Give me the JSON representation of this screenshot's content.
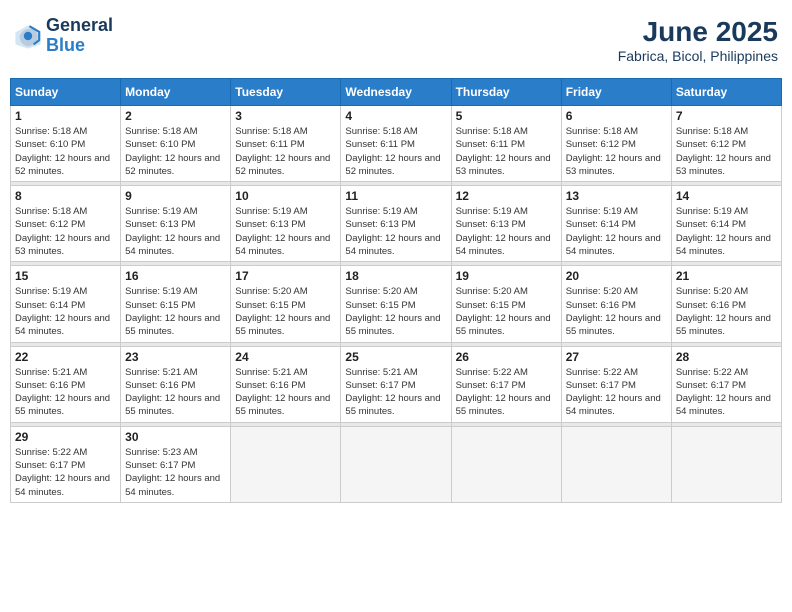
{
  "header": {
    "logo_general": "General",
    "logo_blue": "Blue",
    "title": "June 2025",
    "subtitle": "Fabrica, Bicol, Philippines"
  },
  "weekdays": [
    "Sunday",
    "Monday",
    "Tuesday",
    "Wednesday",
    "Thursday",
    "Friday",
    "Saturday"
  ],
  "weeks": [
    [
      {
        "day": "1",
        "sunrise": "5:18 AM",
        "sunset": "6:10 PM",
        "daylight": "12 hours and 52 minutes."
      },
      {
        "day": "2",
        "sunrise": "5:18 AM",
        "sunset": "6:10 PM",
        "daylight": "12 hours and 52 minutes."
      },
      {
        "day": "3",
        "sunrise": "5:18 AM",
        "sunset": "6:11 PM",
        "daylight": "12 hours and 52 minutes."
      },
      {
        "day": "4",
        "sunrise": "5:18 AM",
        "sunset": "6:11 PM",
        "daylight": "12 hours and 52 minutes."
      },
      {
        "day": "5",
        "sunrise": "5:18 AM",
        "sunset": "6:11 PM",
        "daylight": "12 hours and 53 minutes."
      },
      {
        "day": "6",
        "sunrise": "5:18 AM",
        "sunset": "6:12 PM",
        "daylight": "12 hours and 53 minutes."
      },
      {
        "day": "7",
        "sunrise": "5:18 AM",
        "sunset": "6:12 PM",
        "daylight": "12 hours and 53 minutes."
      }
    ],
    [
      {
        "day": "8",
        "sunrise": "5:18 AM",
        "sunset": "6:12 PM",
        "daylight": "12 hours and 53 minutes."
      },
      {
        "day": "9",
        "sunrise": "5:19 AM",
        "sunset": "6:13 PM",
        "daylight": "12 hours and 54 minutes."
      },
      {
        "day": "10",
        "sunrise": "5:19 AM",
        "sunset": "6:13 PM",
        "daylight": "12 hours and 54 minutes."
      },
      {
        "day": "11",
        "sunrise": "5:19 AM",
        "sunset": "6:13 PM",
        "daylight": "12 hours and 54 minutes."
      },
      {
        "day": "12",
        "sunrise": "5:19 AM",
        "sunset": "6:13 PM",
        "daylight": "12 hours and 54 minutes."
      },
      {
        "day": "13",
        "sunrise": "5:19 AM",
        "sunset": "6:14 PM",
        "daylight": "12 hours and 54 minutes."
      },
      {
        "day": "14",
        "sunrise": "5:19 AM",
        "sunset": "6:14 PM",
        "daylight": "12 hours and 54 minutes."
      }
    ],
    [
      {
        "day": "15",
        "sunrise": "5:19 AM",
        "sunset": "6:14 PM",
        "daylight": "12 hours and 54 minutes."
      },
      {
        "day": "16",
        "sunrise": "5:19 AM",
        "sunset": "6:15 PM",
        "daylight": "12 hours and 55 minutes."
      },
      {
        "day": "17",
        "sunrise": "5:20 AM",
        "sunset": "6:15 PM",
        "daylight": "12 hours and 55 minutes."
      },
      {
        "day": "18",
        "sunrise": "5:20 AM",
        "sunset": "6:15 PM",
        "daylight": "12 hours and 55 minutes."
      },
      {
        "day": "19",
        "sunrise": "5:20 AM",
        "sunset": "6:15 PM",
        "daylight": "12 hours and 55 minutes."
      },
      {
        "day": "20",
        "sunrise": "5:20 AM",
        "sunset": "6:16 PM",
        "daylight": "12 hours and 55 minutes."
      },
      {
        "day": "21",
        "sunrise": "5:20 AM",
        "sunset": "6:16 PM",
        "daylight": "12 hours and 55 minutes."
      }
    ],
    [
      {
        "day": "22",
        "sunrise": "5:21 AM",
        "sunset": "6:16 PM",
        "daylight": "12 hours and 55 minutes."
      },
      {
        "day": "23",
        "sunrise": "5:21 AM",
        "sunset": "6:16 PM",
        "daylight": "12 hours and 55 minutes."
      },
      {
        "day": "24",
        "sunrise": "5:21 AM",
        "sunset": "6:16 PM",
        "daylight": "12 hours and 55 minutes."
      },
      {
        "day": "25",
        "sunrise": "5:21 AM",
        "sunset": "6:17 PM",
        "daylight": "12 hours and 55 minutes."
      },
      {
        "day": "26",
        "sunrise": "5:22 AM",
        "sunset": "6:17 PM",
        "daylight": "12 hours and 55 minutes."
      },
      {
        "day": "27",
        "sunrise": "5:22 AM",
        "sunset": "6:17 PM",
        "daylight": "12 hours and 54 minutes."
      },
      {
        "day": "28",
        "sunrise": "5:22 AM",
        "sunset": "6:17 PM",
        "daylight": "12 hours and 54 minutes."
      }
    ],
    [
      {
        "day": "29",
        "sunrise": "5:22 AM",
        "sunset": "6:17 PM",
        "daylight": "12 hours and 54 minutes."
      },
      {
        "day": "30",
        "sunrise": "5:23 AM",
        "sunset": "6:17 PM",
        "daylight": "12 hours and 54 minutes."
      },
      null,
      null,
      null,
      null,
      null
    ]
  ]
}
